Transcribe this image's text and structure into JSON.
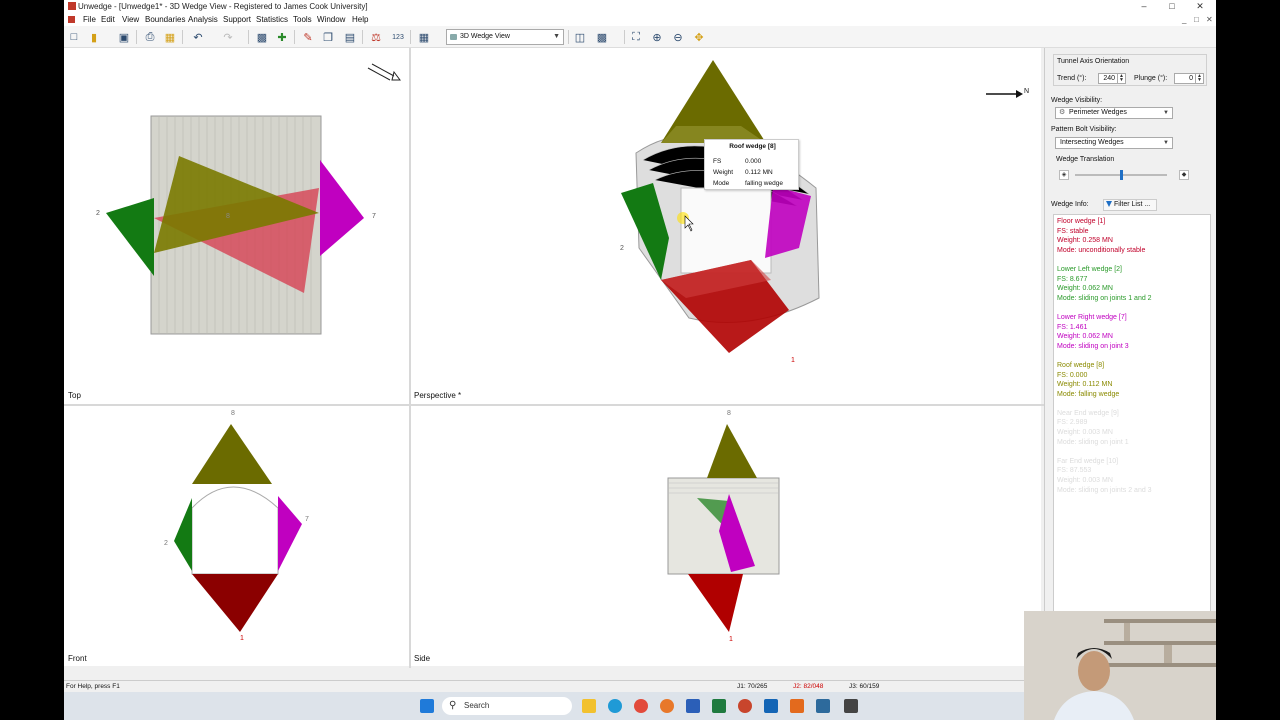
{
  "window": {
    "title": "Unwedge - [Unwedge1* - 3D Wedge View - Registered to James Cook University]",
    "minimize": "–",
    "maximize": "□",
    "close": "✕",
    "mdi_minimize": "_",
    "mdi_restore": "□",
    "mdi_close": "✕"
  },
  "menu": [
    "File",
    "Edit",
    "View",
    "Boundaries",
    "Analysis",
    "Support",
    "Statistics",
    "Tools",
    "Window",
    "Help"
  ],
  "toolbar": {
    "view_select": "3D Wedge View",
    "icons": [
      "new-icon",
      "open-icon",
      "save-icon",
      "print-icon",
      "print-preview-icon",
      "undo-icon",
      "redo-icon",
      "compute-icon",
      "export-icon",
      "edit-icon",
      "copy-icon",
      "report-icon",
      "scale-icon",
      "number-icon",
      "calculator-icon",
      "layout-icon",
      "camera-icon",
      "zoom-extents-icon",
      "zoom-in-icon",
      "zoom-out-icon",
      "pan-icon"
    ]
  },
  "viewports": {
    "top": "Top",
    "perspective": "Perspective *",
    "front": "Front",
    "side": "Side"
  },
  "labels": {
    "top": [
      "2",
      "7",
      "8"
    ],
    "perspective": [
      "2",
      "1",
      "N"
    ],
    "front": [
      "8",
      "2",
      "7",
      "1"
    ],
    "side": [
      "8",
      "1"
    ]
  },
  "tooltip": {
    "title": "Roof wedge [8]",
    "rows": [
      {
        "key": "FS",
        "value": "0.000"
      },
      {
        "key": "Weight",
        "value": "0.112 MN"
      },
      {
        "key": "Mode",
        "value": "falling wedge"
      }
    ]
  },
  "right_panel": {
    "axis_title": "Tunnel Axis Orientation",
    "trend_label": "Trend (°):",
    "trend_value": "240",
    "plunge_label": "Plunge (°):",
    "plunge_value": "0",
    "wedge_visibility_label": "Wedge Visibility:",
    "wedge_visibility_value": "Perimeter Wedges",
    "bolt_visibility_label": "Pattern Bolt Visibility:",
    "bolt_visibility_value": "Intersecting Wedges",
    "translation_label": "Wedge Translation",
    "translation_fraction": 0.5,
    "wedge_info_label": "Wedge Info:",
    "filter_button": "Filter List ...",
    "wedges": [
      {
        "color": "#c0002a",
        "lines": [
          "Floor wedge [1]",
          "FS: stable",
          "Weight: 0.258 MN",
          "Mode: unconditionally stable"
        ]
      },
      {
        "color": "#2a9a2a",
        "lines": [
          "Lower Left wedge [2]",
          "FS: 8.677",
          "Weight: 0.062 MN",
          "Mode: sliding on joints 1 and 2"
        ]
      },
      {
        "color": "#c000c0",
        "lines": [
          "Lower Right wedge [7]",
          "FS: 1.461",
          "Weight: 0.062 MN",
          "Mode: sliding on joint 3"
        ]
      },
      {
        "color": "#8a8a00",
        "lines": [
          "Roof wedge [8]",
          "FS: 0.000",
          "Weight: 0.112 MN",
          "Mode: falling wedge"
        ]
      },
      {
        "color": "#dcdcdc",
        "lines": [
          "Near End wedge [9]",
          "FS: 2.989",
          "Weight: 0.003 MN",
          "Mode: sliding on joint 1"
        ]
      },
      {
        "color": "#dcdcdc",
        "lines": [
          "Far End wedge [10]",
          "FS: 87.553",
          "Weight: 0.003 MN",
          "Mode: sliding on joints 2 and 3"
        ]
      }
    ]
  },
  "status": {
    "help": "For Help, press F1",
    "j1": "J1: 70/265",
    "j2": "J2: 82/048",
    "j3": "J3: 60/159"
  },
  "taskbar": {
    "search": "Search"
  },
  "colors": {
    "roof": "#6b6b00",
    "floor": "#b00000",
    "left": "#137a13",
    "right": "#c000c0",
    "tunnel": "#d4d4cc"
  }
}
